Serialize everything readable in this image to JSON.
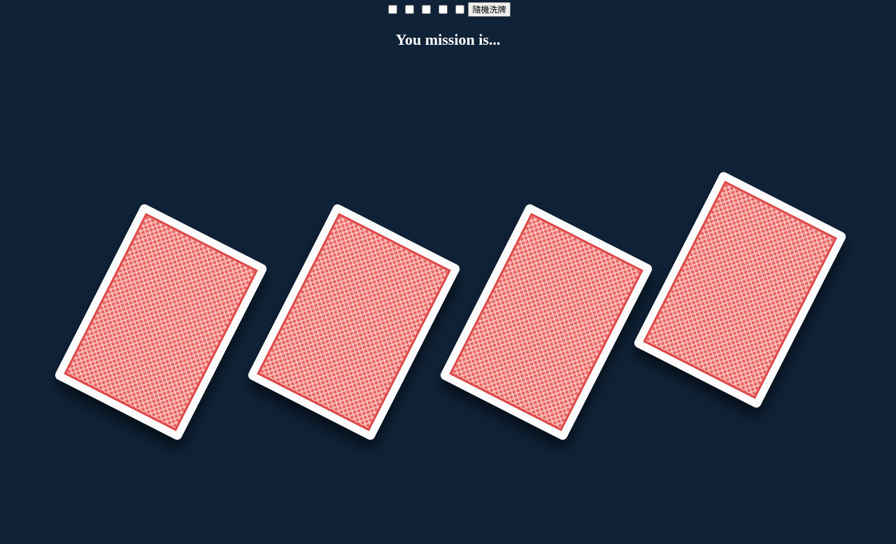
{
  "controls": {
    "checkboxes": [
      false,
      false,
      false,
      false,
      false
    ],
    "shuffle_label": "隨機洗牌"
  },
  "title": "You mission is...",
  "cards": [
    {
      "face": "back",
      "back_color": "#e7645f"
    },
    {
      "face": "back",
      "back_color": "#e7645f"
    },
    {
      "face": "back",
      "back_color": "#e7645f"
    },
    {
      "face": "back",
      "back_color": "#e7645f"
    }
  ],
  "colors": {
    "background": "#0f2237",
    "card_border": "#fbfbfb",
    "card_back_red": "#e7645f",
    "title": "#ffffff"
  }
}
